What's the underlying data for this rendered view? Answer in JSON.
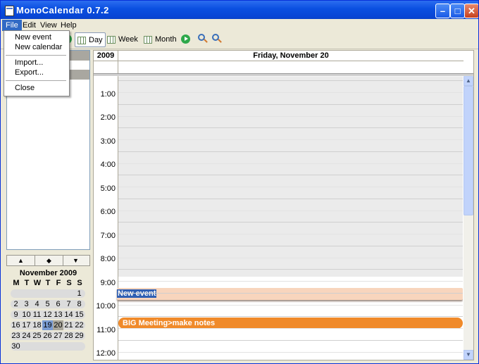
{
  "window": {
    "title": "MonoCalendar 0.7.2",
    "min_glyph": "–",
    "max_glyph": "□",
    "close_glyph": "✕"
  },
  "menu": {
    "file": "File",
    "edit": "Edit",
    "view": "View",
    "help": "Help"
  },
  "file_menu": {
    "new_event": "New event",
    "new_calendar": "New calendar",
    "import": "Import...",
    "export": "Export...",
    "close": "Close"
  },
  "toolbar": {
    "day": "Day",
    "week": "Week",
    "month": "Month"
  },
  "nav": {
    "up": "▲",
    "today": "◆",
    "down": "▼"
  },
  "minical": {
    "title": "November 2009",
    "dow": [
      "M",
      "T",
      "W",
      "T",
      "F",
      "S",
      "S"
    ],
    "weeks": [
      [
        "",
        "",
        "",
        "",
        "",
        "",
        "1"
      ],
      [
        "2",
        "3",
        "4",
        "5",
        "6",
        "7",
        "8"
      ],
      [
        "9",
        "10",
        "11",
        "12",
        "13",
        "14",
        "15"
      ],
      [
        "16",
        "17",
        "18",
        "19",
        "20",
        "21",
        "22"
      ],
      [
        "23",
        "24",
        "25",
        "26",
        "27",
        "28",
        "29"
      ],
      [
        "30",
        "",
        "",
        "",
        "",
        "",
        ""
      ]
    ],
    "today": "19",
    "selected": "20"
  },
  "dayview": {
    "year": "2009",
    "date": "Friday, November 20",
    "hours": [
      "1:00",
      "2:00",
      "3:00",
      "4:00",
      "5:00",
      "6:00",
      "7:00",
      "8:00",
      "9:00",
      "10:00",
      "11:00",
      "12:00"
    ],
    "events": [
      {
        "title": "New event"
      },
      {
        "title": "BIG Meeting>make notes"
      }
    ]
  },
  "colors": {
    "title_bar": "#0a4fe0",
    "event_new": "#f8d5bd",
    "event_meeting": "#f08a2a",
    "today": "#7a9cd3"
  },
  "icons": [
    "app-icon",
    "grid-icon",
    "play-icon",
    "zoom-out-icon",
    "zoom-in-icon"
  ]
}
